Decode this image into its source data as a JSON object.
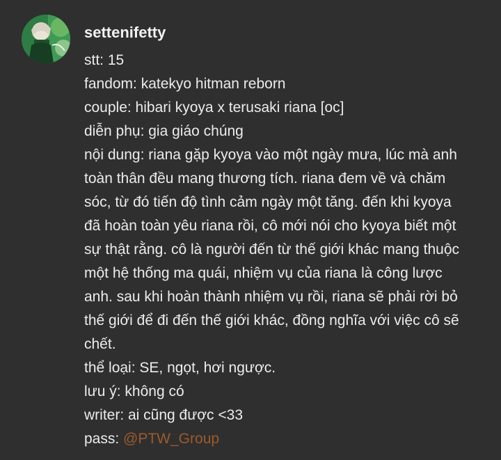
{
  "post": {
    "author": "settenifetty",
    "lines": {
      "stt": "stt: 15",
      "fandom": "fandom: katekyo hitman reborn",
      "couple": "couple: hibari kyoya x terusaki riana [oc]",
      "dien_phu": "diễn phụ: gia giáo chúng",
      "noi_dung_1": "nội dung: riana gặp kyoya vào một ngày mưa, lúc mà anh",
      "noi_dung_2": "toàn thân đều mang thương tích. riana đem về và chăm",
      "noi_dung_3": "sóc, từ đó tiến độ tình cảm ngày một tăng. đến khi kyoya",
      "noi_dung_4": "đã hoàn toàn yêu riana rồi, cô mới nói cho kyoya biết một",
      "noi_dung_5": "sự thật rằng. cô là người đến từ thế giới khác mang thuộc",
      "noi_dung_6": "một hệ thống ma quái, nhiệm vụ của riana là công lược",
      "noi_dung_7": "anh. sau khi hoàn thành nhiệm vụ rồi, riana sẽ phải rời bỏ",
      "noi_dung_8": "thế giới để đi đến thế giới khác, đồng nghĩa với việc cô sẽ",
      "noi_dung_9": "chết.",
      "the_loai": "thể loại: SE, ngọt, hơi ngược.",
      "luu_y": "lưu ý: không có",
      "writer": "writer: ai cũng được <33",
      "pass_label": "pass: ",
      "pass_link": "@PTW_Group"
    }
  },
  "colors": {
    "background": "#2f2f2f",
    "text": "#ececec",
    "link": "#9e5a2c"
  },
  "icons": {
    "avatar": "profile-picture"
  }
}
